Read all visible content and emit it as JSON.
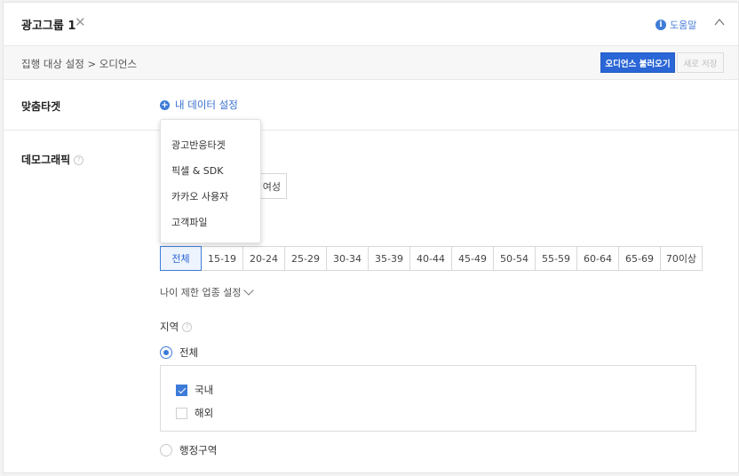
{
  "header": {
    "title": "광고그룹 1",
    "help_label": "도움말"
  },
  "subheader": {
    "breadcrumb": "집행 대상 설정 > 오디언스",
    "load_audience_label": "오디언스 불러오기",
    "save_new_label": "새로 저장"
  },
  "custom_target": {
    "label": "맞춤타겟",
    "add_data_label": "내 데이터 설정",
    "menu_items": [
      "광고반응타겟",
      "픽셀 & SDK",
      "카카오 사용자",
      "고객파일"
    ]
  },
  "demographic": {
    "label": "데모그래픽",
    "gender_partial_label": "여성",
    "age_options": [
      "전체",
      "15-19",
      "20-24",
      "25-29",
      "30-34",
      "35-39",
      "40-44",
      "45-49",
      "50-54",
      "55-59",
      "60-64",
      "65-69",
      "70이상"
    ],
    "age_selected": "전체",
    "age_limit_label": "나이 제한 업종 설정",
    "region": {
      "label": "지역",
      "all_label": "전체",
      "domestic_label": "국내",
      "domestic_checked": true,
      "overseas_label": "해외",
      "overseas_checked": false,
      "admin_district_label": "행정구역",
      "selected": "전체"
    }
  },
  "colors": {
    "accent": "#2a66d6",
    "link": "#3a6fcf"
  }
}
